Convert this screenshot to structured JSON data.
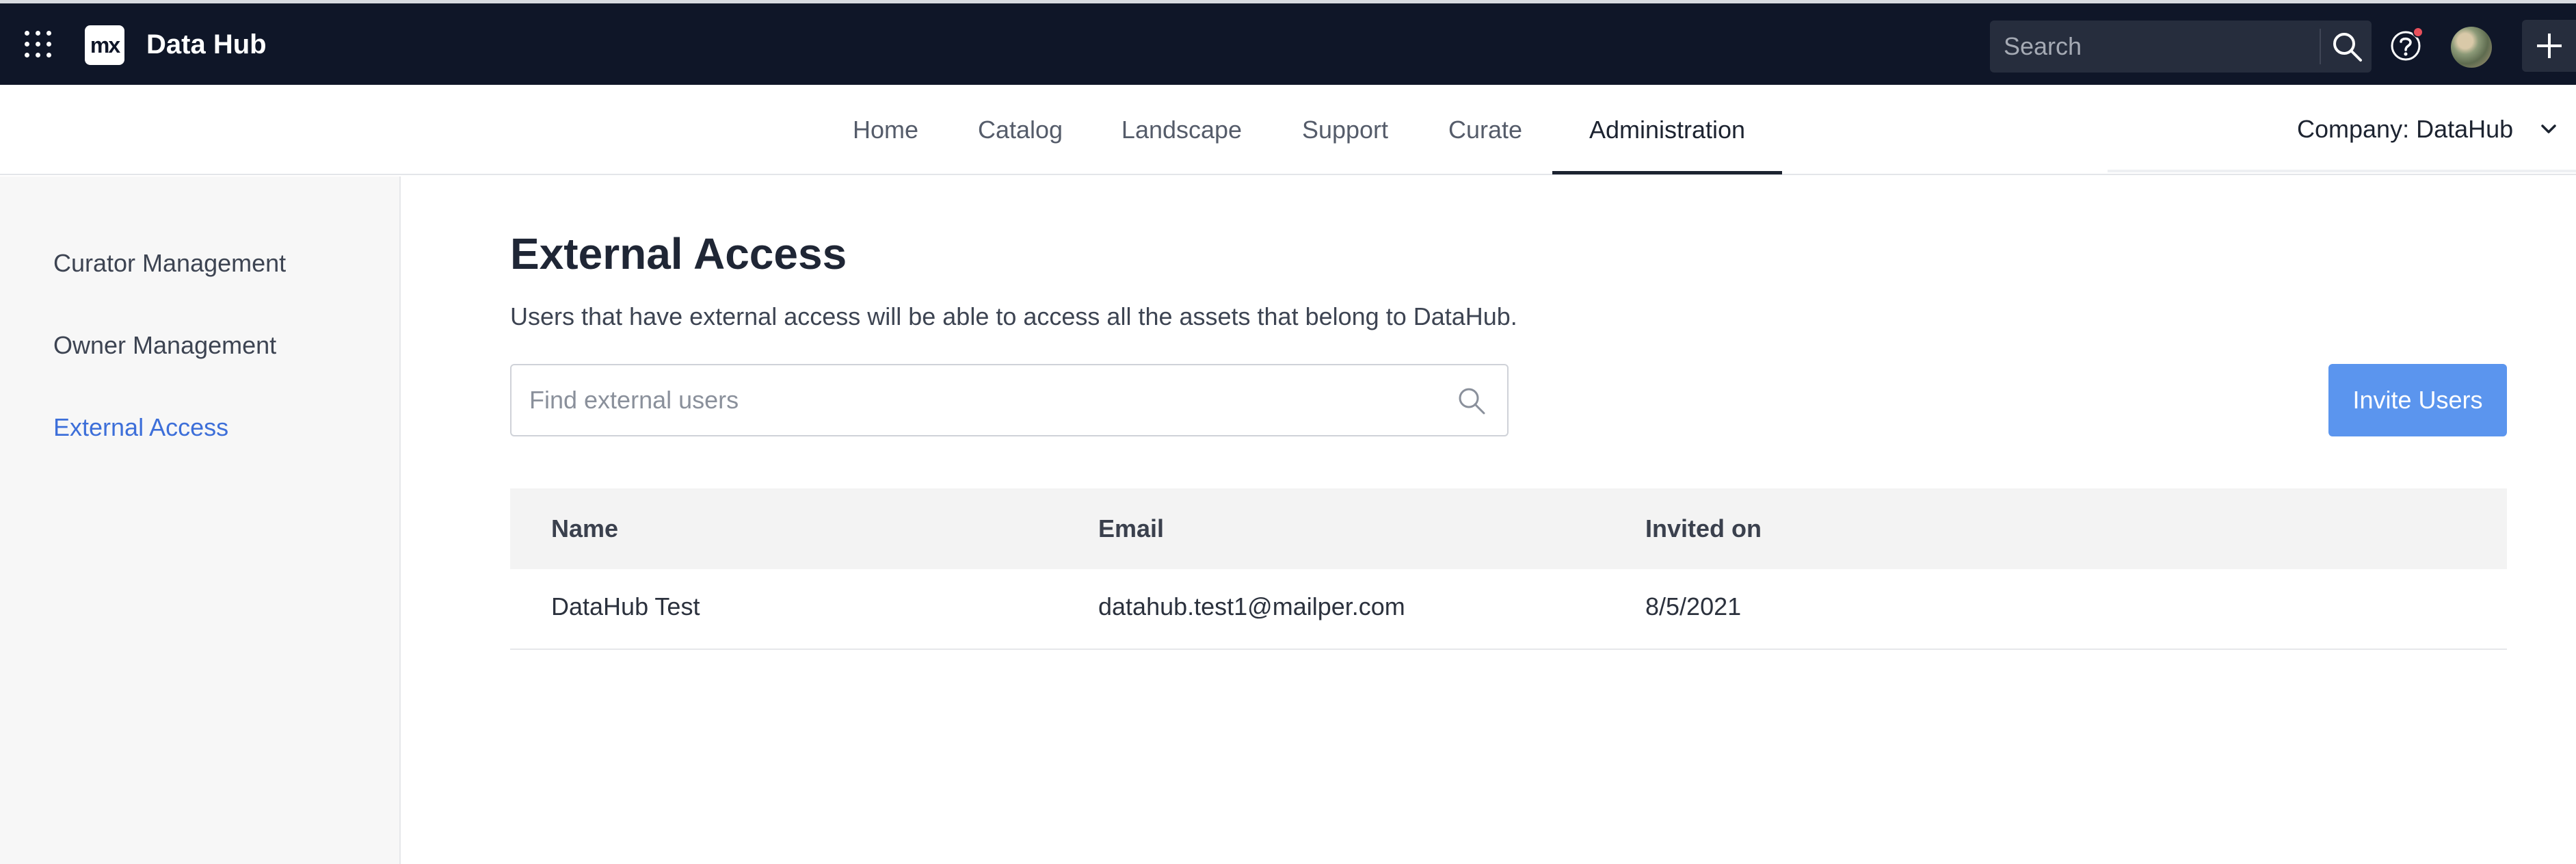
{
  "topbar": {
    "app_title": "Data Hub",
    "logo_text": "mx",
    "search_placeholder": "Search",
    "icons": [
      "apps-grid-icon",
      "search-icon",
      "help-icon",
      "avatar",
      "plus-icon"
    ]
  },
  "nav": {
    "tabs": [
      {
        "label": "Home",
        "active": false
      },
      {
        "label": "Catalog",
        "active": false
      },
      {
        "label": "Landscape",
        "active": false
      },
      {
        "label": "Support",
        "active": false
      },
      {
        "label": "Curate",
        "active": false
      },
      {
        "label": "Administration",
        "active": true
      }
    ],
    "company_label": "Company:",
    "company_value": "DataHub"
  },
  "sidebar": {
    "items": [
      {
        "label": "Curator Management",
        "active": false
      },
      {
        "label": "Owner Management",
        "active": false
      },
      {
        "label": "External Access",
        "active": true
      }
    ]
  },
  "main": {
    "title": "External Access",
    "description": "Users that have external access will be able to access all the assets that belong to DataHub.",
    "search_placeholder": "Find external users",
    "invite_button": "Invite Users",
    "table": {
      "columns": [
        "Name",
        "Email",
        "Invited on"
      ],
      "rows": [
        {
          "name": "DataHub Test",
          "email": "datahub.test1@mailper.com",
          "invited_on": "8/5/2021"
        }
      ]
    }
  },
  "colors": {
    "topbar_bg": "#0f1628",
    "accent": "#5b95ee",
    "active_link": "#3d6fd9",
    "notification": "#e8505b"
  }
}
